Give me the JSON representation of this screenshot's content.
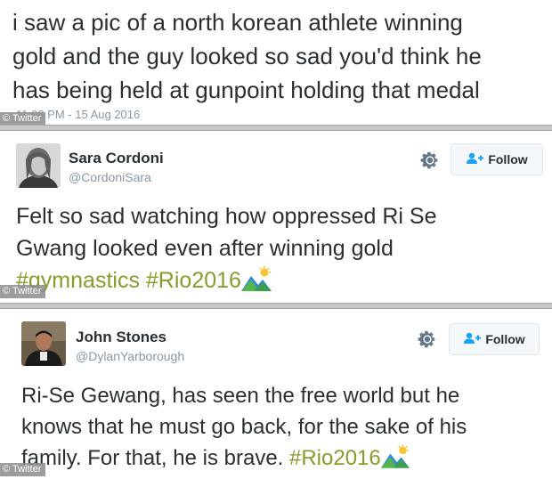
{
  "credit": "© Twitter",
  "tweets": [
    {
      "text_lines": [
        "i saw a pic of a north korean athlete winning",
        "gold and the guy looked so sad you'd think he",
        "has being held at gunpoint holding that medal"
      ],
      "timestamp": "11:08 PM - 15 Aug 2016"
    },
    {
      "name": "Sara Cordoni",
      "handle": "@CordoniSara",
      "follow_label": "Follow",
      "text_lines": [
        "Felt so sad watching how oppressed Ri Se",
        "Gwang looked even after winning gold"
      ],
      "hashtags": [
        "#gymnastics",
        "#Rio2016"
      ]
    },
    {
      "name": "John Stones",
      "handle": "@DylanYarborough",
      "follow_label": "Follow",
      "text_lines": [
        "Ri-Se Gewang, has seen the free world but he",
        "knows that he must go back, for the sake of his",
        "family. For that, he is brave."
      ],
      "hashtags": [
        "#Rio2016"
      ]
    }
  ],
  "icons": {
    "gear": "gear-icon",
    "follow": "add-user-icon",
    "emoji": "landscape-emoji-icon"
  },
  "colors": {
    "hashtag": "#8a9a2b",
    "text": "#292f33",
    "muted": "#8899a6",
    "follow_icon": "#1da1f2"
  }
}
